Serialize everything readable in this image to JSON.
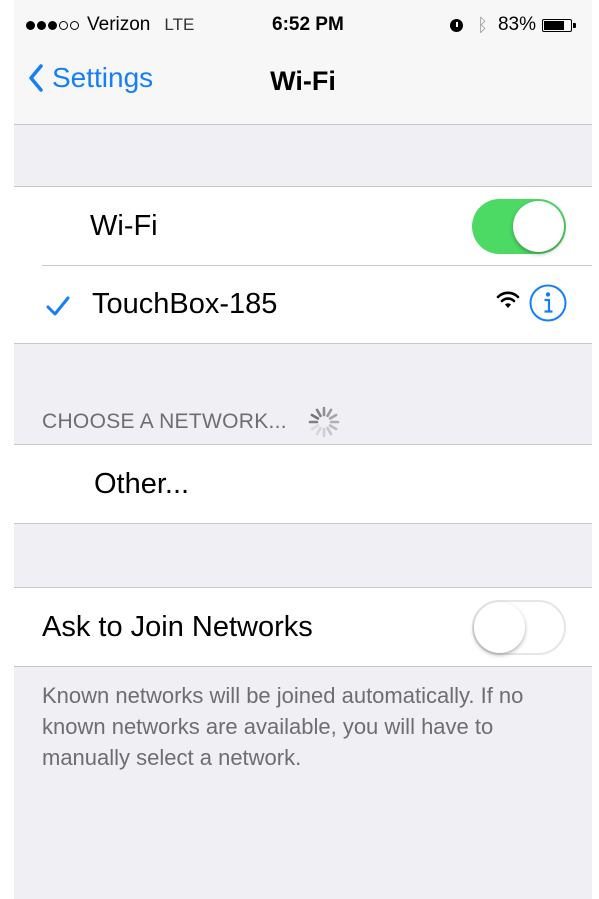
{
  "status_bar": {
    "carrier": "Verizon",
    "network": "LTE",
    "time": "6:52 PM",
    "battery_percent": "83%",
    "battery_level": 0.83,
    "signal_bars_filled": 3,
    "signal_bars_total": 5,
    "bluetooth_icon": "bluetooth-icon",
    "alarm_icon": "alarm-icon"
  },
  "nav": {
    "back_label": "Settings",
    "title": "Wi-Fi"
  },
  "wifi": {
    "label": "Wi-Fi",
    "enabled": true,
    "connected_network": "TouchBox-185"
  },
  "choose_network": {
    "header": "CHOOSE A NETWORK...",
    "other_label": "Other..."
  },
  "ask_to_join": {
    "label": "Ask to Join Networks",
    "enabled": false,
    "description": "Known networks will be joined automatically. If no known networks are available, you will have to manually select a network."
  },
  "colors": {
    "accent": "#147efb",
    "switch_on": "#4cd964",
    "background": "#efeff4",
    "secondary_text": "#6d6d72"
  }
}
